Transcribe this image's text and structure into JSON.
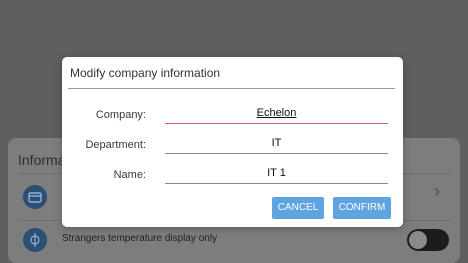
{
  "background": {
    "section_title": "Informa",
    "row_icon_1": "card-icon",
    "row_icon_2": "temperature-icon",
    "toggle_row_label": "Strangers temperature display only",
    "toggle_state": "off"
  },
  "dialog": {
    "title": "Modify company information",
    "fields": [
      {
        "label": "Company:",
        "value": "Echelon",
        "active": true
      },
      {
        "label": "Department:",
        "value": "IT",
        "active": false
      },
      {
        "label": "Name:",
        "value": "IT 1",
        "active": false
      }
    ],
    "cancel_label": "CANCEL",
    "confirm_label": "CONFIRM",
    "accent_color": "#5fa3e0",
    "active_underline_color": "#d35e7c"
  }
}
